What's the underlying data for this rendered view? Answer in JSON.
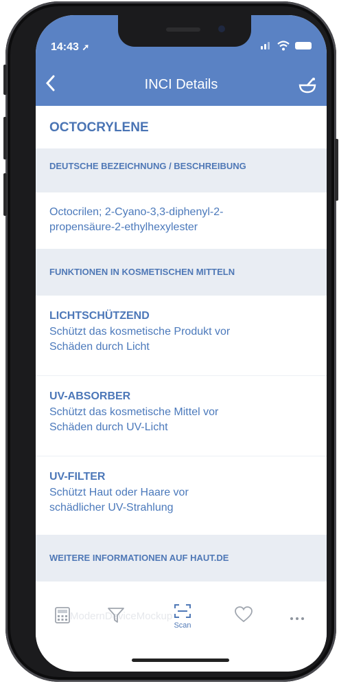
{
  "status_bar": {
    "time": "14:43"
  },
  "header": {
    "title": "INCI Details",
    "back_icon": "chevron-left-icon",
    "action_icon": "mortar-bowl-icon"
  },
  "ingredient": {
    "name": "OCTOCRYLENE"
  },
  "sections": {
    "german_name_heading": "DEUTSCHE BEZEICHNUNG / BESCHREIBUNG",
    "german_name_line1": "Octocrilen; 2-Cyano-3,3-diphenyl-2-",
    "german_name_line2": "propensäure-2-ethylhexylester",
    "functions_heading": "FUNKTIONEN IN KOSMETISCHEN MITTELN",
    "more_info_heading": "WEITERE INFORMATIONEN AUF HAUT.DE"
  },
  "functions": [
    {
      "name": "LICHTSCHÜTZEND",
      "line1": "Schützt das kosmetische Produkt vor",
      "line2": "Schäden durch Licht"
    },
    {
      "name": "UV-ABSORBER",
      "line1": "Schützt das kosmetische Mittel vor",
      "line2": "Schäden durch UV-Licht"
    },
    {
      "name": "UV-FILTER",
      "line1": "Schützt Haut oder Haare vor",
      "line2": "schädlicher UV-Strahlung"
    }
  ],
  "tabbar": {
    "scan_label": "Scan",
    "watermark": "ModernDeviceMockup",
    "icons": [
      "calculator-icon",
      "filter-icon",
      "scan-icon",
      "heart-icon",
      "more-icon"
    ]
  },
  "colors": {
    "header": "#5a82c4",
    "accent_text": "#4a74b4",
    "section_bg": "#e9edf3"
  }
}
